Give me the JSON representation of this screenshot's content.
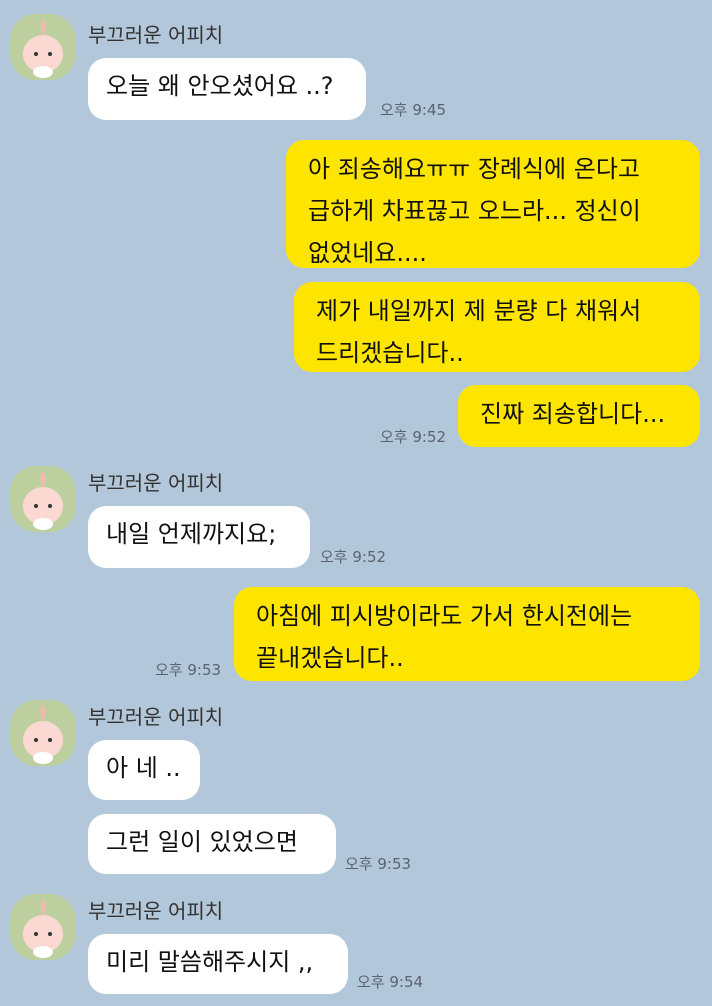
{
  "colors": {
    "background": "#b2c7d9",
    "incoming_bubble": "#ffffff",
    "outgoing_bubble": "#fee500",
    "avatar_bg": "#bdcf9e"
  },
  "sender_name": "부끄러운 어피치",
  "messages": [
    {
      "dir": "in",
      "text": "오늘 왜 안오셨어요 ..?"
    },
    {
      "dir": "out",
      "text": "아 죄송해요ㅠㅠ 장례식에 온다고\n급하게 차표끊고 오느라... 정신이\n없었네요...."
    },
    {
      "dir": "out",
      "text": "제가 내일까지 제 분량 다 채워서\n드리겠습니다.."
    },
    {
      "dir": "out",
      "text": "진짜 죄송합니다..."
    },
    {
      "dir": "in",
      "text": "내일 언제까지요;"
    },
    {
      "dir": "out",
      "text": "아침에 피시방이라도 가서 한시전에는\n끝내겠습니다.."
    },
    {
      "dir": "in",
      "text": "아 네 .."
    },
    {
      "dir": "in",
      "text": "그런 일이 있었으면"
    },
    {
      "dir": "in",
      "text": "미리 말씀해주시지 ,,"
    }
  ],
  "timestamps": [
    "오후 9:45",
    "오후 9:52",
    "오후 9:52",
    "오후 9:53",
    "오후 9:53",
    "오후 9:54"
  ]
}
